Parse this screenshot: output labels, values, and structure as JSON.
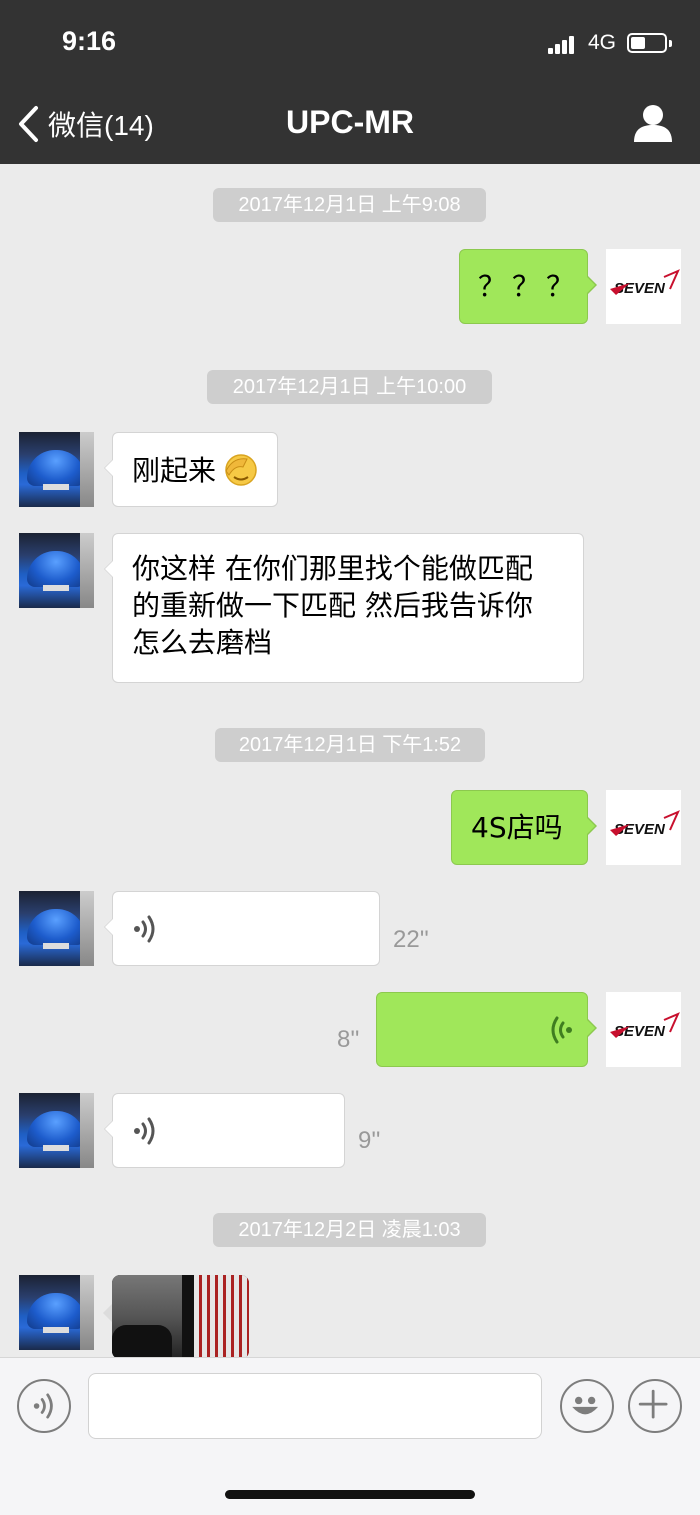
{
  "status_bar": {
    "time": "9:16",
    "network": "4G"
  },
  "nav": {
    "back_label": "微信(14)",
    "title": "UPC-MR"
  },
  "timestamps": [
    "2017年12月1日 上午9:08",
    "2017年12月1日 上午10:00",
    "2017年12月1日 下午1:52",
    "2017年12月2日 凌晨1:03"
  ],
  "messages": [
    {
      "from": "me",
      "type": "text",
      "text": "？？？"
    },
    {
      "from": "contact",
      "type": "text",
      "text": "刚起来"
    },
    {
      "from": "contact",
      "type": "text",
      "lines": [
        "你这样 在你们那里找个能做匹配",
        "的重新做一下匹配 然后我告诉你",
        "怎么去磨档"
      ]
    },
    {
      "from": "me",
      "type": "text",
      "text": "4S店吗"
    },
    {
      "from": "contact",
      "type": "voice",
      "duration": "22''"
    },
    {
      "from": "me",
      "type": "voice",
      "duration": "8''"
    },
    {
      "from": "contact",
      "type": "voice",
      "duration": "9''"
    },
    {
      "from": "contact",
      "type": "image"
    }
  ],
  "icons": {
    "back": "chevron-left-icon",
    "profile": "person-icon",
    "voice_toggle": "voice-icon",
    "emoji": "smiley-icon",
    "more": "plus-icon",
    "facepalm": "facepalm-emoji",
    "my_avatar_logo": "SEVEN"
  },
  "colors": {
    "header": "#333333",
    "chat_bg": "#ebebeb",
    "out_bubble": "#a0e75a",
    "in_bubble": "#ffffff",
    "timestamp_bg": "#cecece"
  }
}
